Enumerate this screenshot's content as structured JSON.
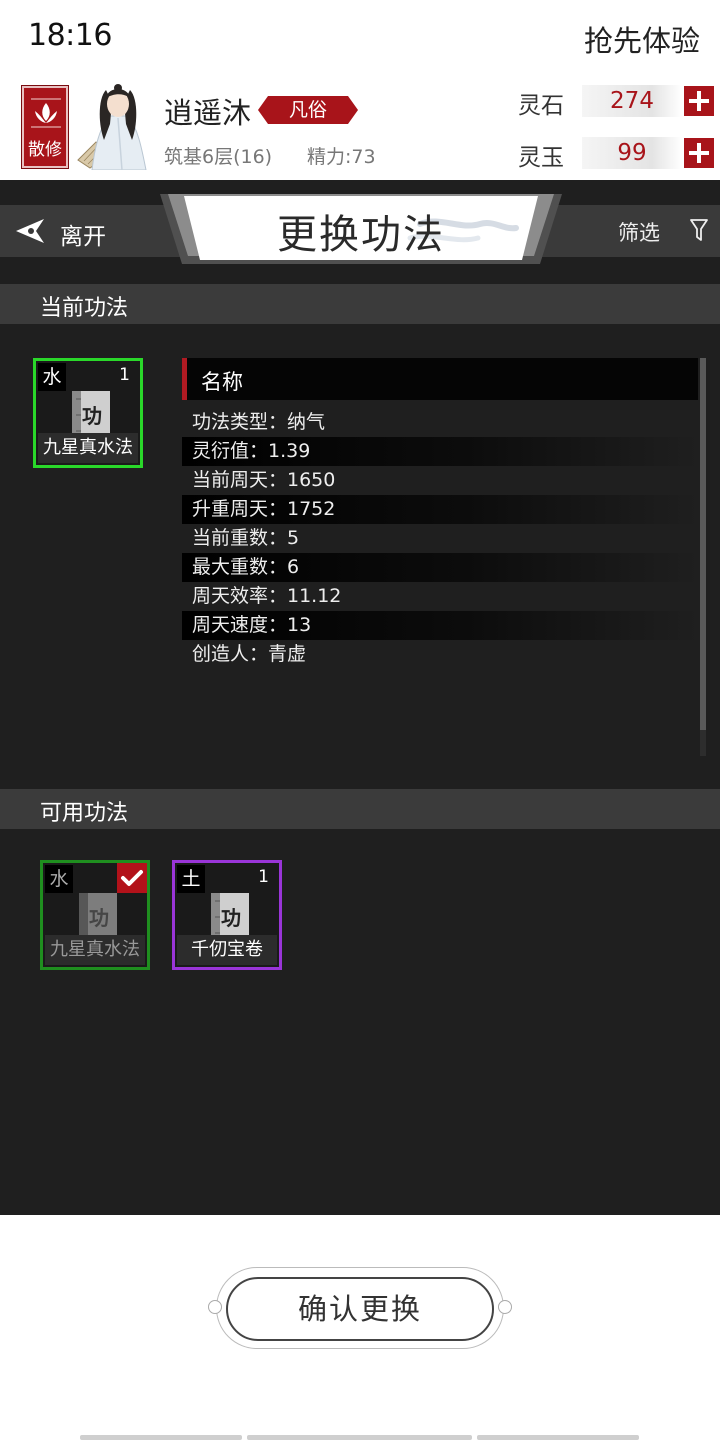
{
  "status_bar": {
    "time": "18:16",
    "right_text": "抢先体验"
  },
  "player": {
    "sect": "散修",
    "name": "逍遥沐",
    "rank": "凡俗",
    "realm": "筑基6层(16)",
    "energy": "精力:73"
  },
  "currency": {
    "stone_label": "灵石",
    "stone_value": "274",
    "jade_label": "灵玉",
    "jade_value": "99"
  },
  "nav": {
    "back_label": "离开",
    "title": "更换功法",
    "filter_label": "筛选"
  },
  "current_section": {
    "title": "当前功法",
    "skill": {
      "element": "水",
      "level": "1",
      "icon_glyph": "功",
      "name": "九星真水法",
      "border_color": "#2ad82a"
    }
  },
  "details": {
    "header": "名称",
    "rows": [
      "功法类型：纳气",
      "灵衍值：1.39",
      "当前周天：1650",
      "升重周天：1752",
      "当前重数：5",
      "最大重数：6",
      "周天效率：11.12",
      "周天速度：13",
      "创造人：青虚"
    ]
  },
  "available_section": {
    "title": "可用功法",
    "skills": [
      {
        "element": "水",
        "level": "",
        "icon_glyph": "功",
        "name": "九星真水法",
        "equipped": true,
        "border_color": "#1f8f1f"
      },
      {
        "element": "土",
        "level": "1",
        "icon_glyph": "功",
        "name": "千仞宝卷",
        "equipped": false,
        "border_color": "#9a35d8"
      }
    ]
  },
  "confirm_label": "确认更换",
  "colors": {
    "accent_red": "#a8141a",
    "panel_dark": "#1f1f1f",
    "section_bar": "#3b3b3b"
  }
}
